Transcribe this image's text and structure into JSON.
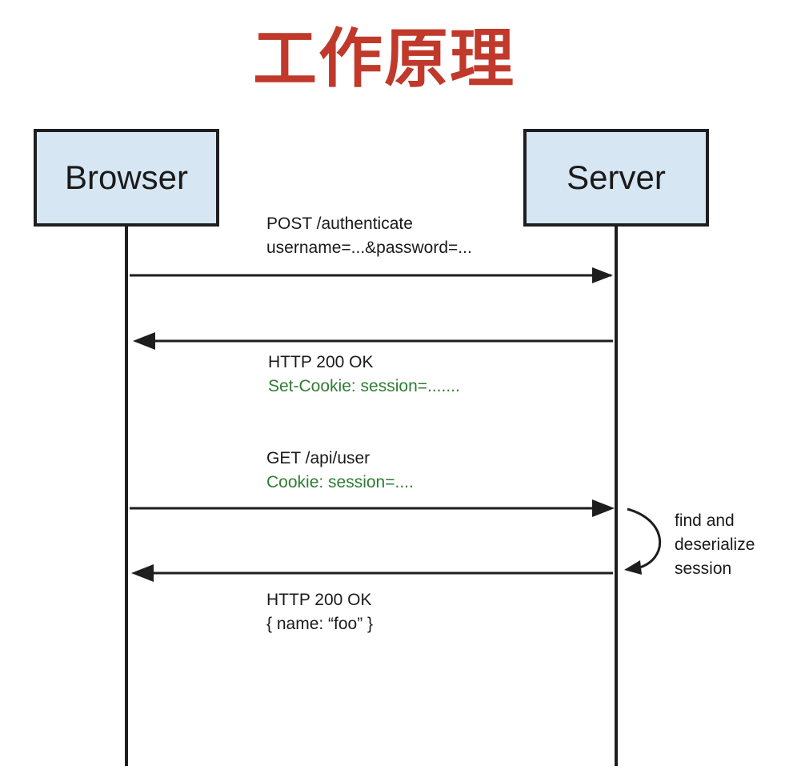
{
  "title": "工作原理",
  "colors": {
    "title": "#c0392b",
    "actor_fill": "#d6e6f2",
    "line": "#1e1e1e",
    "text": "#1a1a1a",
    "highlight_text": "#2e7d32"
  },
  "actors": {
    "browser": "Browser",
    "server": "Server"
  },
  "messages": [
    {
      "line1": "POST /authenticate",
      "line2": "username=...&password=...",
      "direction": "browser-to-server"
    },
    {
      "line1": "HTTP 200 OK",
      "line2": "Set-Cookie: session=.......",
      "direction": "server-to-browser"
    },
    {
      "line1": "GET /api/user",
      "line2": "Cookie: session=....",
      "direction": "browser-to-server"
    },
    {
      "line1": "HTTP 200 OK",
      "line2": "{  name: “foo” }",
      "direction": "server-to-browser"
    }
  ],
  "self_note": {
    "line1": "find and",
    "line2": "deserialize",
    "line3": "session"
  }
}
